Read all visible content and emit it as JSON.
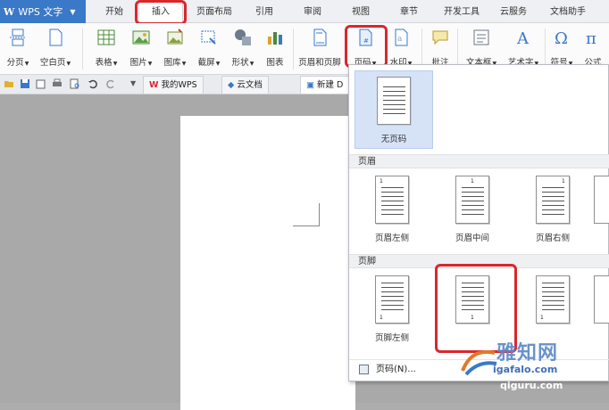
{
  "app": {
    "title": "WPS 文字"
  },
  "ribbon_tabs": [
    "开始",
    "插入",
    "页面布局",
    "引用",
    "审阅",
    "视图",
    "章节",
    "开发工具",
    "云服务",
    "文档助手"
  ],
  "active_tab": "插入",
  "ribbon": {
    "page_break": "分页",
    "blank_page": "空白页",
    "table": "表格",
    "picture": "图片",
    "gallery": "图库",
    "screenshot": "截屏",
    "shapes": "形状",
    "chart": "图表",
    "header_footer": "页眉和页脚",
    "page_number": "页码",
    "watermark": "水印",
    "comment": "批注",
    "textbox": "文本框",
    "wordart": "艺术字",
    "symbol": "符号",
    "formula": "公式"
  },
  "doc_tabs": {
    "my_wps": "我的WPS",
    "cloud_docs": "云文档",
    "new_doc": "新建 D"
  },
  "gallery": {
    "none_label": "无页码",
    "header_section": "页眉",
    "header_items": [
      "页眉左侧",
      "页眉中间",
      "页眉右侧"
    ],
    "footer_section": "页脚",
    "footer_items": [
      "页脚左侧"
    ],
    "page_number_num": "1",
    "more_menu": "页码(N)..."
  },
  "watermark": {
    "text1": "雅知网",
    "text2": "igafalo.com",
    "text3": "qiguru.com"
  },
  "colors": {
    "accent": "#3a78c8",
    "highlight_box": "#d9272e",
    "selected_bg": "#d6e3f7"
  }
}
